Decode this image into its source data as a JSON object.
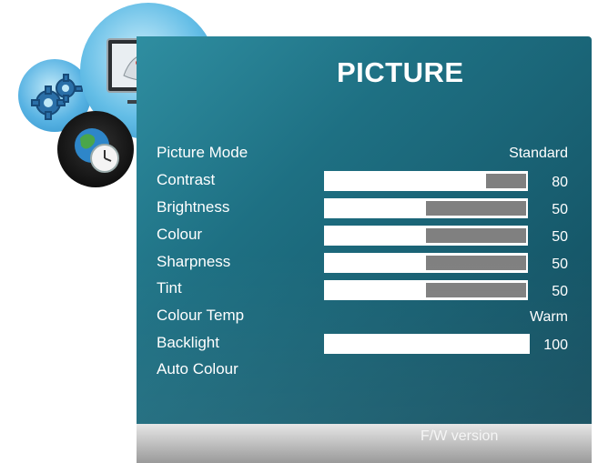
{
  "menu": {
    "title": "PICTURE",
    "footer_text": "F/W version",
    "items": [
      {
        "label": "Picture Mode",
        "value": "Standard"
      },
      {
        "label": "Contrast",
        "value": "80",
        "level": 0.2
      },
      {
        "label": "Brightness",
        "value": "50",
        "level": 0.5
      },
      {
        "label": "Colour",
        "value": "50",
        "level": 0.5
      },
      {
        "label": "Sharpness",
        "value": "50",
        "level": 0.5
      },
      {
        "label": "Tint",
        "value": "50",
        "level": 0.5
      },
      {
        "label": "Colour Temp",
        "value": "Warm"
      },
      {
        "label": "Backlight",
        "value": "100",
        "level": 0.0
      },
      {
        "label": "Auto Colour",
        "value": ""
      }
    ]
  },
  "icons": {
    "settings": "gear-icon",
    "picture": "monitor-icon",
    "time": "globe-clock-icon"
  },
  "colors": {
    "panel": "#1e7083",
    "bar": "#ffffff",
    "bar_fill": "#808080"
  }
}
